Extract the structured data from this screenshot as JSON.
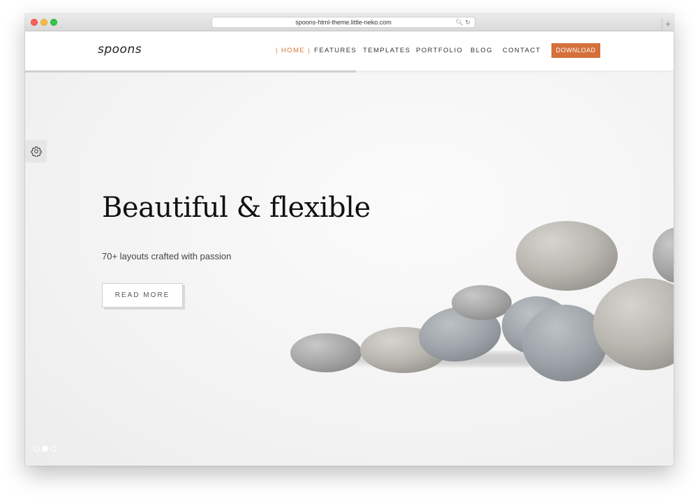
{
  "browser": {
    "url": "spoons-html-theme.little-neko.com",
    "new_tab_symbol": "+"
  },
  "header": {
    "logo": "spoons",
    "nav": [
      {
        "label": "| HOME |",
        "active": true
      },
      {
        "label": "FEATURES",
        "active": false
      },
      {
        "label": "TEMPLATES",
        "active": false
      },
      {
        "label": "PORTFOLIO",
        "active": false
      },
      {
        "label": "BLOG",
        "active": false
      },
      {
        "label": "CONTACT",
        "active": false
      }
    ],
    "download_label": "DOWNLOAD",
    "scroll_progress": 0.51
  },
  "hero": {
    "title": "Beautiful & flexible",
    "subtitle": "70+ layouts crafted with passion",
    "cta_label": "READ MORE",
    "slides": 3,
    "active_slide": 2
  },
  "colors": {
    "accent": "#d4703a",
    "active_nav": "#d4763b"
  },
  "icons": [
    "lock-icon",
    "reload-icon",
    "gear-icon"
  ]
}
